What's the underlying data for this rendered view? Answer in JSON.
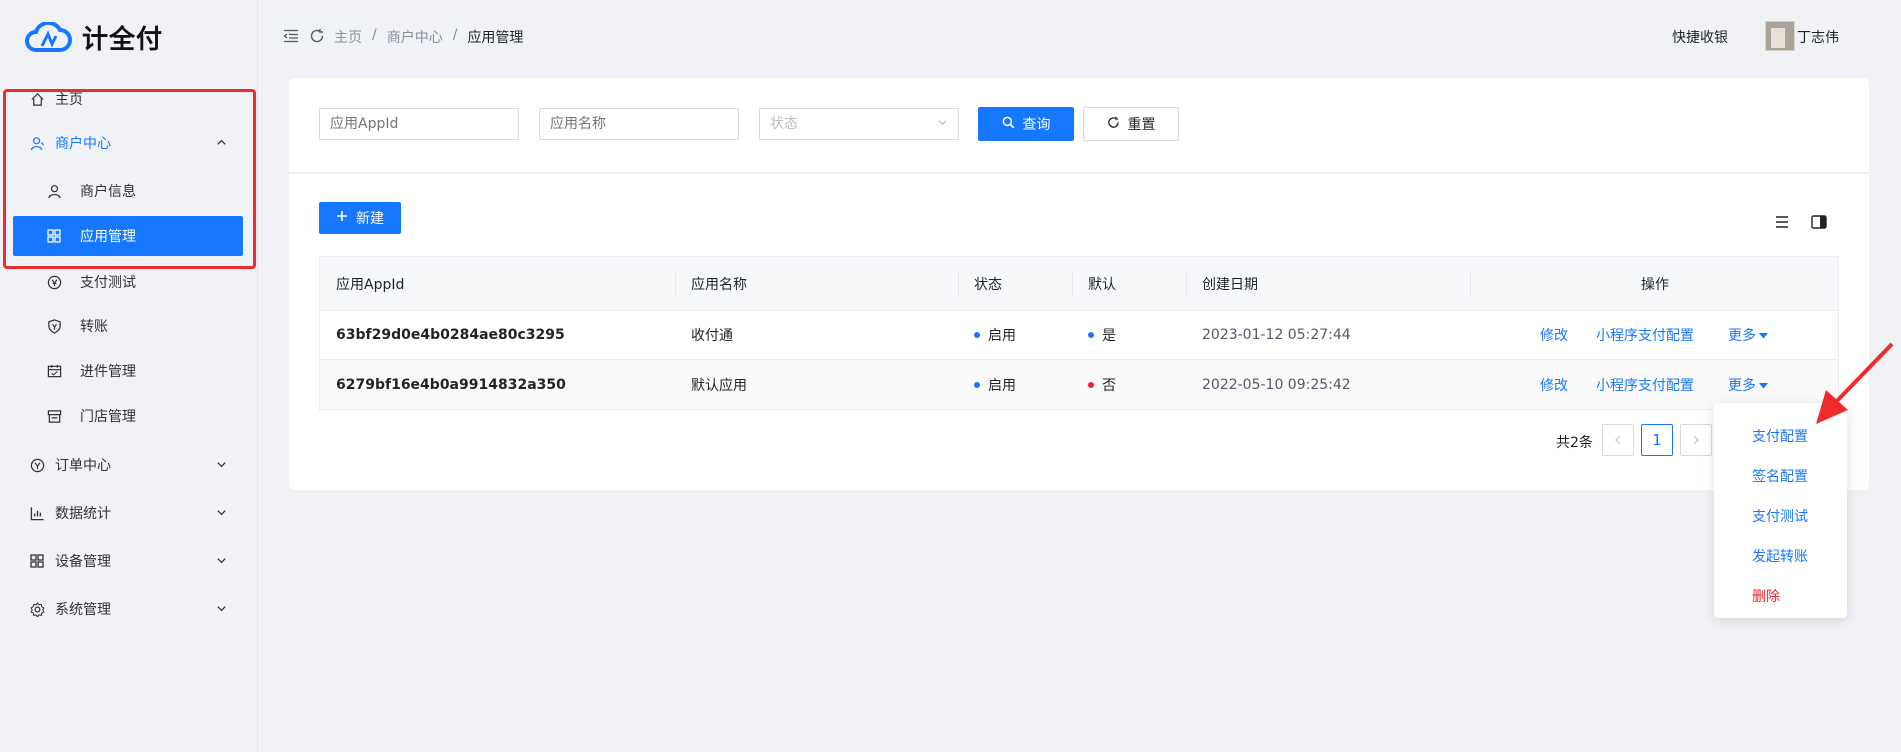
{
  "app": {
    "logo_text": "计全付"
  },
  "sidebar": {
    "items": [
      {
        "label": "主页",
        "icon": "home-icon"
      },
      {
        "label": "商户中心",
        "icon": "merchant-icon"
      },
      {
        "label": "商户信息",
        "icon": "user-icon"
      },
      {
        "label": "应用管理",
        "icon": "grid-icon"
      },
      {
        "label": "支付测试",
        "icon": "payment-icon"
      },
      {
        "label": "转账",
        "icon": "shield-icon"
      },
      {
        "label": "进件管理",
        "icon": "calendar-icon"
      },
      {
        "label": "门店管理",
        "icon": "store-icon"
      },
      {
        "label": "订单中心",
        "icon": "payment-icon"
      },
      {
        "label": "数据统计",
        "icon": "chart-icon"
      },
      {
        "label": "设备管理",
        "icon": "grid-icon"
      },
      {
        "label": "系统管理",
        "icon": "gear-icon"
      }
    ]
  },
  "header": {
    "breadcrumb": [
      "主页",
      "商户中心",
      "应用管理"
    ],
    "separator": "/",
    "quick_cashier": "快捷收银",
    "user_name": "丁志伟"
  },
  "search": {
    "appid_placeholder": "应用AppId",
    "name_placeholder": "应用名称",
    "status_placeholder": "状态",
    "query_label": "查询",
    "reset_label": "重置"
  },
  "toolbar": {
    "new_label": "新建"
  },
  "table": {
    "columns": [
      "应用AppId",
      "应用名称",
      "状态",
      "默认",
      "创建日期",
      "操作"
    ],
    "rows": [
      {
        "appid": "63bf29d0e4b0284ae80c3295",
        "name": "收付通",
        "status": "启用",
        "default": "是",
        "created": "2023-01-12 05:27:44",
        "actions": [
          "修改",
          "小程序支付配置",
          "更多"
        ]
      },
      {
        "appid": "6279bf16e4b0a9914832a350",
        "name": "默认应用",
        "status": "启用",
        "default": "否",
        "created": "2022-05-10 09:25:42",
        "actions": [
          "修改",
          "小程序支付配置",
          "更多"
        ]
      }
    ]
  },
  "pagination": {
    "total_text": "共2条",
    "current_page": "1"
  },
  "dropdown": {
    "items": [
      "支付配置",
      "签名配置",
      "支付测试",
      "发起转账",
      "删除"
    ]
  },
  "colors": {
    "primary": "#1677ff",
    "danger": "#f5222d",
    "highlight_box": "#f02b2b"
  }
}
